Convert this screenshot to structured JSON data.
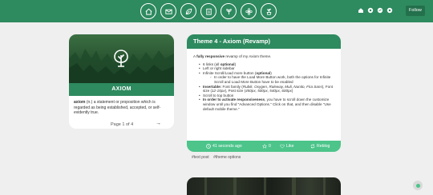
{
  "nav": {
    "icons": [
      "home-icon",
      "mail-icon",
      "leaf-icon",
      "clipboard-icon",
      "sprout-icon",
      "flower-icon",
      "potted-plant-icon"
    ],
    "tumblr_icons": [
      "home-icon",
      "dashboard-icon",
      "share-icon",
      "gear-icon"
    ],
    "follow_label": "Follow"
  },
  "sidebar": {
    "title": "AXIOM",
    "desc_term": "axiom",
    "desc_rest": " (n.) a statement or proposition which is regarded as being established, accepted, or self-evidently true.",
    "pager_text": "Page 1 of 4",
    "next_arrow": "→"
  },
  "post": {
    "title": "Theme 4 - Axiom (Revamp)",
    "intro_pre": "A ",
    "intro_bold": "fully responsive",
    "intro_post": " revamp of my Axiom theme.",
    "items": {
      "links": "6 links (all ",
      "links_opt": "optional",
      "links_end": ")",
      "sidebar": "Left or right sidebar",
      "scroll_pre": "Infinite Scroll/Load more button (",
      "scroll_opt": "optional",
      "scroll_end": ")",
      "scroll_sub": "In order to have the Load More Button work, both the options for Infinite Scroll and Load More Button have to be enabled",
      "inserts_label": "Insertable:",
      "inserts_text": " Font family (",
      "fonts": "Rubik, Oxygen, Raleway, Muli, Nunito, Fira Sans",
      "inserts_mid": "), Font size (",
      "fsizes": "12-15px",
      "inserts_mid2": "), Post size (",
      "psizes": "450px, 500px, 540px, 600px",
      "inserts_end": ")",
      "scrolltop": "Scroll to top button",
      "resp_label": "In order to activate responsiveness",
      "resp_text": ", you have to scroll down the customize window until you find \"Advanced Options.\" Click on that, and then disable \"Use default mobile theme.\""
    },
    "footer": {
      "time": "41 seconds ago",
      "notes": "0",
      "like": "Like",
      "reblog": "Reblog"
    },
    "tags": [
      "#text post",
      "#theme options"
    ]
  },
  "colors": {
    "accent": "#2e8a5f",
    "accent_light": "#4cc48a",
    "background": "#efefef"
  }
}
